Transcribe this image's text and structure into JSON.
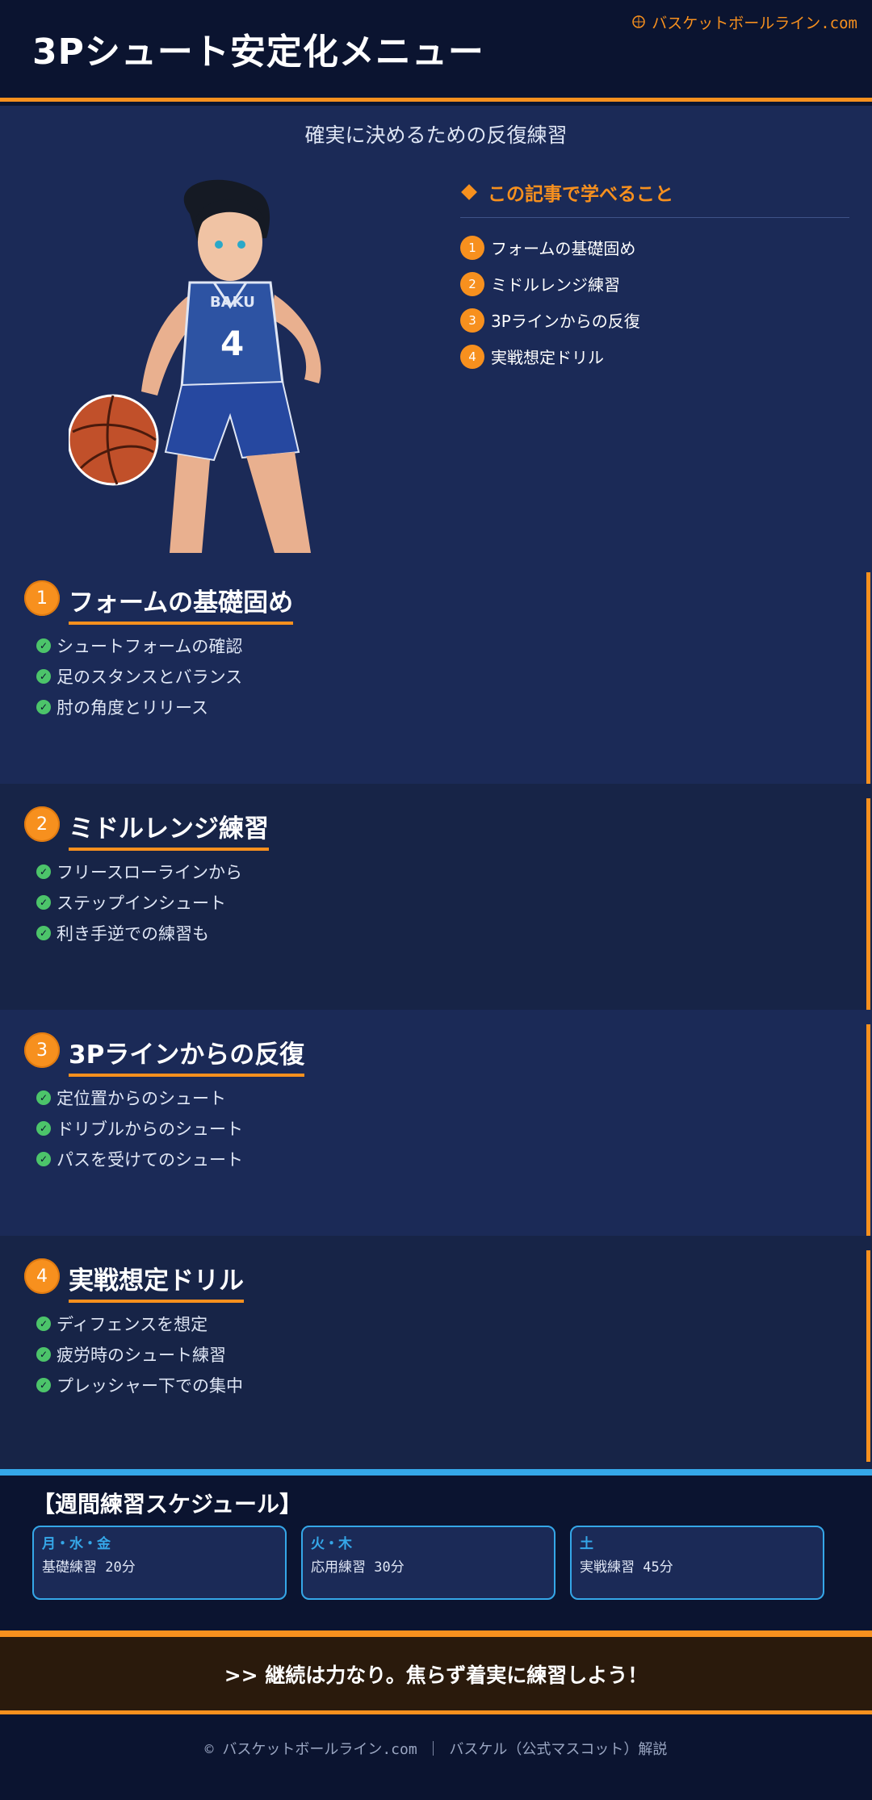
{
  "header": {
    "title": "3Pシュート安定化メニュー",
    "site_tag": "バスケットボールライン.com",
    "site_icon": "basketball-icon"
  },
  "subtitle": "確実に決めるための反復練習",
  "toc": {
    "heading": "この記事で学べること",
    "items": [
      {
        "num": "1",
        "label": "フォームの基礎固め"
      },
      {
        "num": "2",
        "label": "ミドルレンジ練習"
      },
      {
        "num": "3",
        "label": "3Pラインからの反復"
      },
      {
        "num": "4",
        "label": "実戦想定ドリル"
      }
    ]
  },
  "sections": [
    {
      "num": "1",
      "title": "フォームの基礎固め",
      "items": [
        "シュートフォームの確認",
        "足のスタンスとバランス",
        "肘の角度とリリース"
      ]
    },
    {
      "num": "2",
      "title": "ミドルレンジ練習",
      "items": [
        "フリースローラインから",
        "ステップインシュート",
        "利き手逆での練習も"
      ]
    },
    {
      "num": "3",
      "title": "3Pラインからの反復",
      "items": [
        "定位置からのシュート",
        "ドリブルからのシュート",
        "パスを受けてのシュート"
      ]
    },
    {
      "num": "4",
      "title": "実戦想定ドリル",
      "items": [
        "ディフェンスを想定",
        "疲労時のシュート練習",
        "プレッシャー下での集中"
      ]
    }
  ],
  "schedule": {
    "title": "【週間練習スケジュール】",
    "cards": [
      {
        "days": "月・水・金",
        "desc": "基礎練習 20分"
      },
      {
        "days": "火・木",
        "desc": "応用練習 30分"
      },
      {
        "days": "土",
        "desc": "実戦練習 45分"
      }
    ]
  },
  "motto": ">> 継続は力なり。焦らず着実に練習しよう！",
  "footer": "© バスケットボールライン.com ｜ バスケル（公式マスコット）解説",
  "colors": {
    "accent_orange": "#f7901e",
    "accent_blue": "#35a7e8",
    "check_green": "#4cc46a",
    "background_navy": "#1b2a57"
  },
  "jersey_number": "4"
}
